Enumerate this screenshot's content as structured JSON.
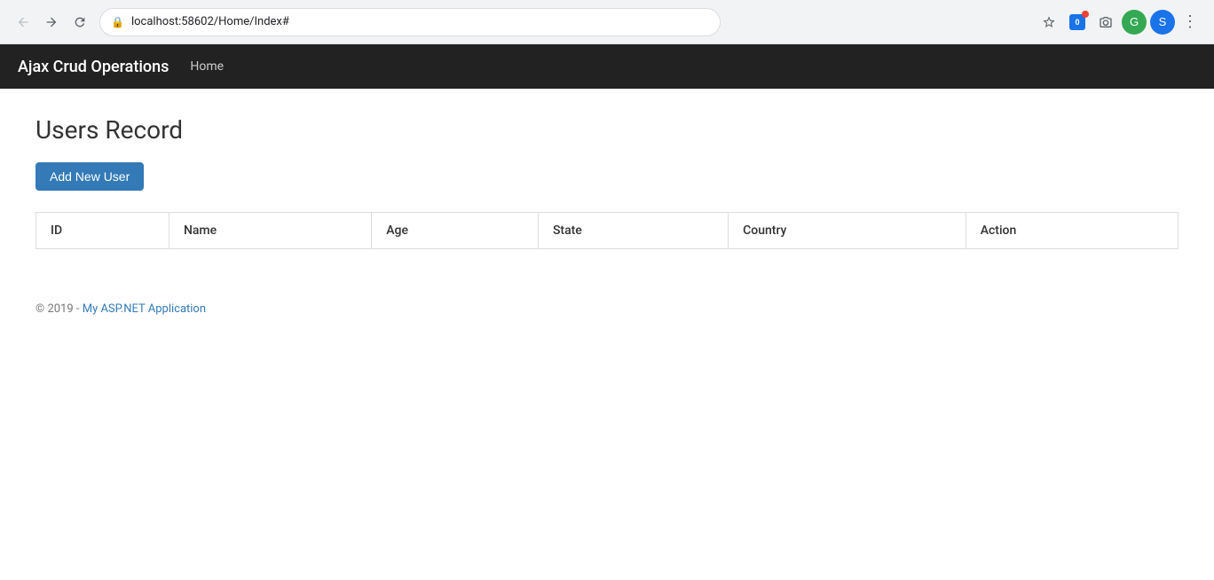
{
  "browser": {
    "url": "localhost:58602/Home/Index#",
    "lock_icon": "🔒"
  },
  "navbar": {
    "brand": "Ajax Crud Operations",
    "links": [
      {
        "label": "Home",
        "href": "#"
      }
    ]
  },
  "page": {
    "title": "Users Record",
    "add_button_label": "Add New User"
  },
  "table": {
    "columns": [
      {
        "key": "id",
        "label": "ID"
      },
      {
        "key": "name",
        "label": "Name"
      },
      {
        "key": "age",
        "label": "Age"
      },
      {
        "key": "state",
        "label": "State"
      },
      {
        "key": "country",
        "label": "Country"
      },
      {
        "key": "action",
        "label": "Action"
      }
    ],
    "rows": []
  },
  "footer": {
    "text": "© 2019 - My ASP.NET Application"
  }
}
